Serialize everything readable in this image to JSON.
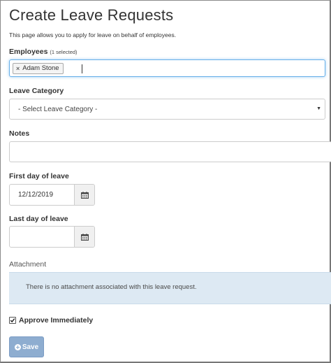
{
  "page": {
    "title": "Create Leave Requests",
    "intro": "This page allows you to apply for leave on behalf of employees."
  },
  "employees": {
    "label": "Employees",
    "count_note": "(1 selected)",
    "selected": [
      {
        "name": "Adam Stone",
        "remove_glyph": "×"
      }
    ]
  },
  "leave_category": {
    "label": "Leave Category",
    "selected": "- Select Leave Category -",
    "arrow_glyph": "▼"
  },
  "notes": {
    "label": "Notes",
    "value": ""
  },
  "first_day": {
    "label": "First day of leave",
    "value": "12/12/2019",
    "icon": "calendar-icon"
  },
  "last_day": {
    "label": "Last day of leave",
    "value": "",
    "icon": "calendar-icon"
  },
  "attachment": {
    "label": "Attachment",
    "message": "There is no attachment associated with this leave request."
  },
  "approve": {
    "label": "Approve Immediately",
    "checked": true
  },
  "save_button": {
    "label": "Save",
    "icon": "plus-circle-icon"
  },
  "colors": {
    "focus_border": "#66afe9",
    "attachment_panel": "#dde9f3",
    "save_button": "#8eadd0"
  }
}
